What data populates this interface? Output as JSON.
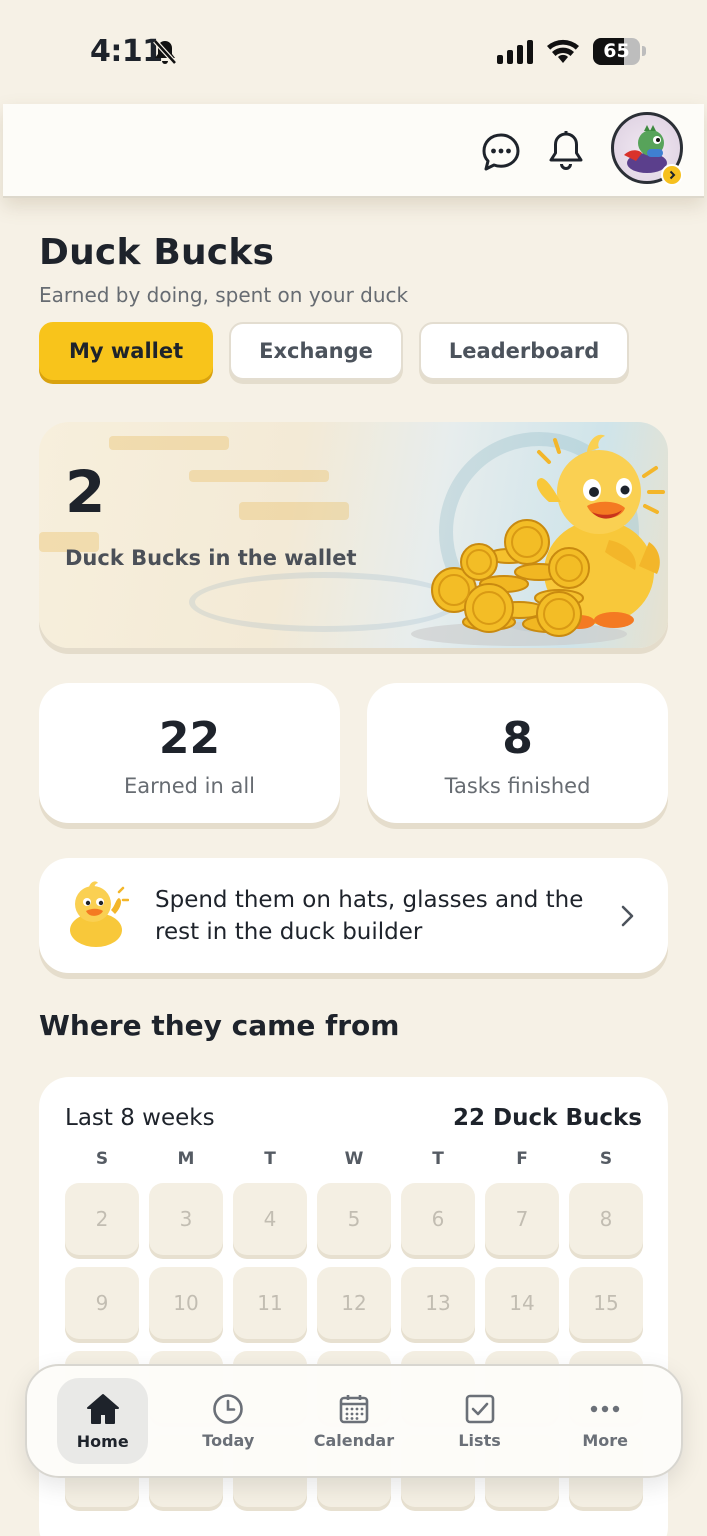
{
  "status_bar": {
    "time": "4:11",
    "battery": "65",
    "battery_level": 0.65
  },
  "header": {
    "title": "Duck Bucks",
    "subtitle": "Earned by doing, spent on your duck"
  },
  "tabs": [
    {
      "label": "My wallet",
      "active": true
    },
    {
      "label": "Exchange",
      "active": false
    },
    {
      "label": "Leaderboard",
      "active": false
    }
  ],
  "wallet": {
    "amount": "2",
    "caption": "Duck Bucks in the wallet"
  },
  "stats": [
    {
      "value": "22",
      "label": "Earned in all"
    },
    {
      "value": "8",
      "label": "Tasks finished"
    }
  ],
  "promo": {
    "text": "Spend them on hats, glasses and the rest in the duck builder"
  },
  "history": {
    "section_title": "Where they came from",
    "period": "Last 8 weeks",
    "total": "22 Duck Bucks",
    "weekdays": [
      "S",
      "M",
      "T",
      "W",
      "T",
      "F",
      "S"
    ],
    "days": [
      "2",
      "3",
      "4",
      "5",
      "6",
      "7",
      "8",
      "9",
      "10",
      "11",
      "12",
      "13",
      "14",
      "15"
    ]
  },
  "nav": [
    {
      "label": "Home",
      "icon": "home-icon",
      "active": true
    },
    {
      "label": "Today",
      "icon": "clock-icon",
      "active": false
    },
    {
      "label": "Calendar",
      "icon": "calendar-icon",
      "active": false
    },
    {
      "label": "Lists",
      "icon": "checkbox-icon",
      "active": false
    },
    {
      "label": "More",
      "icon": "more-dots-icon",
      "active": false
    }
  ],
  "colors": {
    "accent": "#f8c41b",
    "background": "#f6f1e6",
    "text": "#1e232b"
  }
}
